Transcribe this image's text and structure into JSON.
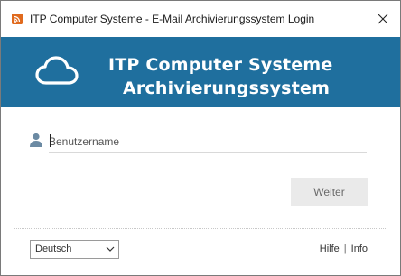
{
  "window": {
    "title": "ITP Computer Systeme - E-Mail Archivierungssystem Login"
  },
  "banner": {
    "line1": "ITP Computer Systeme",
    "line2": "Archivierungssystem",
    "background": "#1f6f9e",
    "icon": "cloud-icon"
  },
  "login": {
    "username_placeholder": "Benutzername",
    "username_value": "",
    "user_icon": "user-icon",
    "submit_label": "Weiter"
  },
  "footer": {
    "language_selected": "Deutsch",
    "help_label": "Hilfe",
    "separator": "|",
    "info_label": "Info"
  },
  "colors": {
    "accent": "#1f6f9e",
    "app_icon": "#e06a1e",
    "button_bg": "#eaeaea",
    "user_icon": "#6b8aa3"
  }
}
